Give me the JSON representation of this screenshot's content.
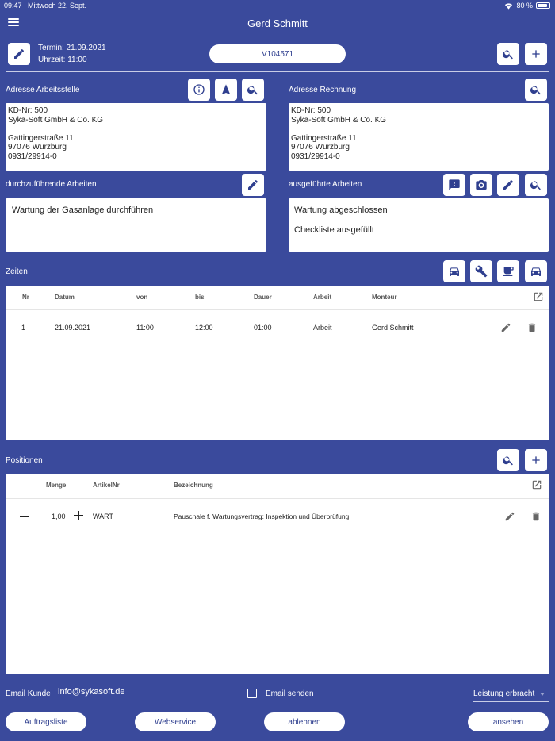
{
  "status_bar": {
    "time": "09:47",
    "date": "Mittwoch 22. Sept.",
    "battery": "80 %"
  },
  "header": {
    "title": "Gerd Schmitt"
  },
  "appointment": {
    "termin": "Termin: 21.09.2021",
    "uhrzeit": "Uhrzeit: 11:00",
    "order_no": "V104571"
  },
  "address_work": {
    "label": "Adresse Arbeitsstelle",
    "lines": [
      "KD-Nr: 500",
      "Syka-Soft GmbH & Co. KG",
      "",
      "Gattingerstraße 11",
      "97076 Würzburg",
      "0931/29914-0"
    ]
  },
  "address_bill": {
    "label": "Adresse Rechnung",
    "lines": [
      "KD-Nr: 500",
      "Syka-Soft GmbH & Co. KG",
      "",
      "Gattingerstraße 11",
      "97076 Würzburg",
      "0931/29914-0"
    ]
  },
  "work_todo": {
    "label": "durchzuführende Arbeiten",
    "text": "Wartung der Gasanlage durchführen"
  },
  "work_done": {
    "label": "ausgeführte Arbeiten",
    "lines": [
      "Wartung abgeschlossen",
      "Checkliste ausgefüllt"
    ]
  },
  "times": {
    "label": "Zeiten",
    "columns": [
      "Nr",
      "Datum",
      "von",
      "bis",
      "Dauer",
      "Arbeit",
      "Monteur"
    ],
    "rows": [
      {
        "nr": "1",
        "datum": "21.09.2021",
        "von": "11:00",
        "bis": "12:00",
        "dauer": "01:00",
        "arbeit": "Arbeit",
        "monteur": "Gerd Schmitt"
      }
    ]
  },
  "positions": {
    "label": "Positionen",
    "columns": [
      "Menge",
      "ArtikelNr",
      "Bezeichnung"
    ],
    "rows": [
      {
        "menge": "1,00",
        "artikel": "WART",
        "bezeichnung": "Pauschale f. Wartungsvertrag: Inspektion und Überprüfung"
      }
    ]
  },
  "footer": {
    "email_label": "Email Kunde",
    "email_value": "info@sykasoft.de",
    "send_label": "Email senden",
    "status_select": "Leistung erbracht",
    "buttons": {
      "list": "Auftragsliste",
      "web": "Webservice",
      "reject": "ablehnen",
      "view": "ansehen"
    }
  },
  "icons": {
    "accent": "#3a4a9c",
    "panel": "#ffffff"
  }
}
